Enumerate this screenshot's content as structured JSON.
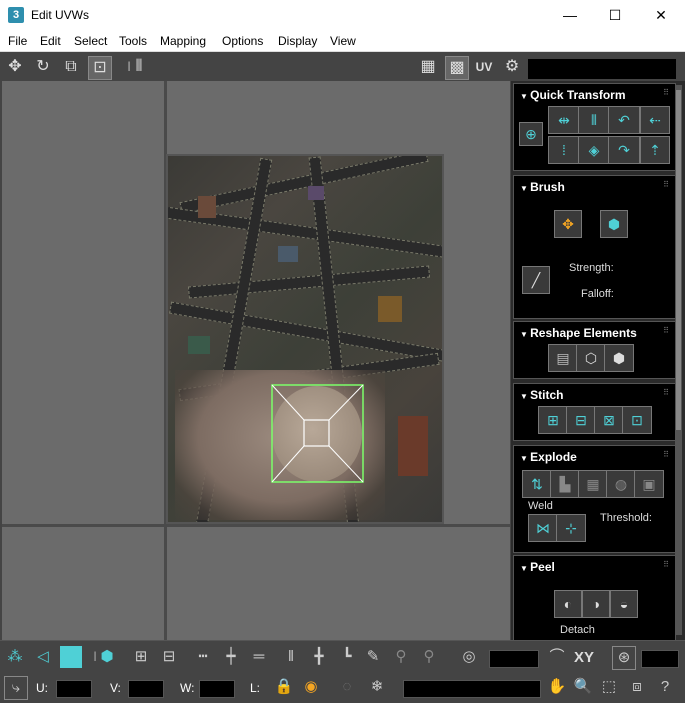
{
  "window": {
    "title": "Edit UVWs",
    "app_icon_label": "3",
    "minimize": "—",
    "maximize": "☐",
    "close": "✕"
  },
  "menu": [
    "File",
    "Edit",
    "Select",
    "Tools",
    "Mapping",
    "Options",
    "Display",
    "View"
  ],
  "toolbar": {
    "uv_label": "UV"
  },
  "panel": {
    "quick_transform": {
      "title": "Quick Transform"
    },
    "brush": {
      "title": "Brush",
      "strength_label": "Strength:",
      "falloff_label": "Falloff:"
    },
    "reshape": {
      "title": "Reshape Elements"
    },
    "stitch": {
      "title": "Stitch"
    },
    "explode": {
      "title": "Explode",
      "weld_label": "Weld",
      "threshold_label": "Threshold:"
    },
    "peel": {
      "title": "Peel",
      "detach_label": "Detach"
    }
  },
  "bottom": {
    "xy_label": "XY",
    "u_label": "U:",
    "v_label": "V:",
    "w_label": "W:",
    "l_label": "L:"
  },
  "colors": {
    "accent": "#4fd0d6",
    "selection": "#7cff6a",
    "viewport_bg": "#6b6b6b",
    "panel_bg": "#000000"
  }
}
